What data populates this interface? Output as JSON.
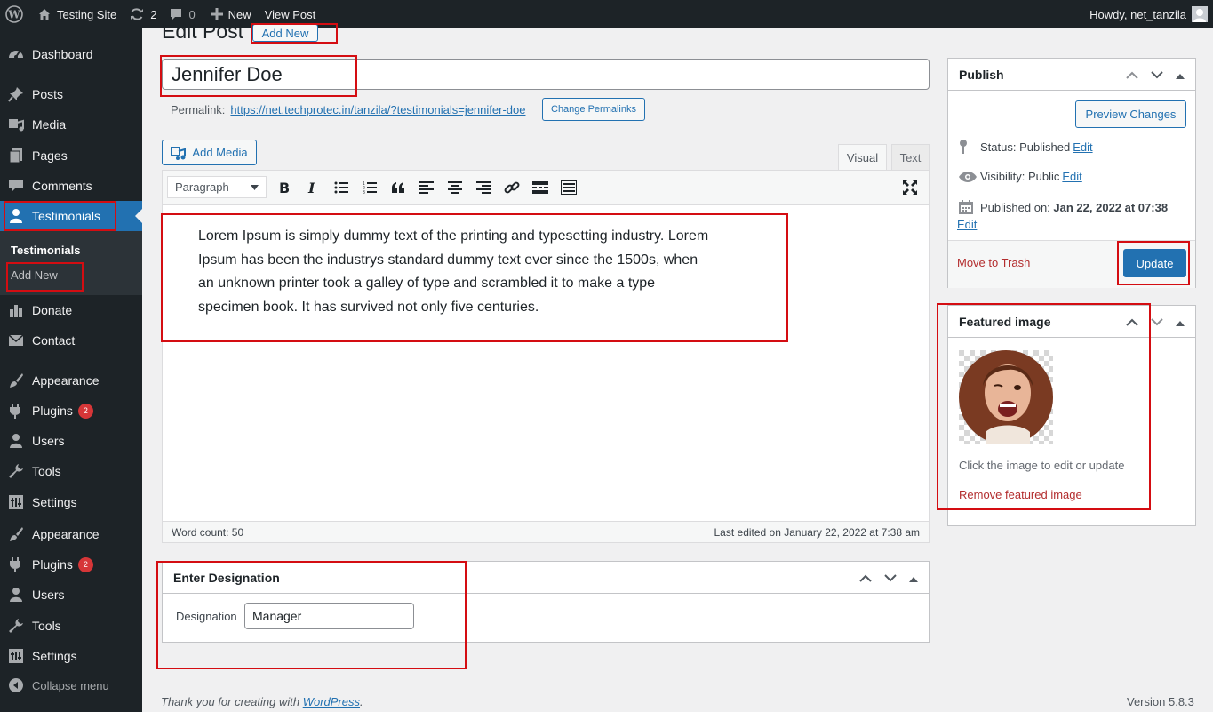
{
  "adminbar": {
    "site_name": "Testing Site",
    "updates_count": "2",
    "comments_count": "0",
    "new_label": "New",
    "view_post_label": "View Post",
    "howdy": "Howdy, net_tanzila"
  },
  "sidebar": {
    "items": [
      {
        "label": "Dashboard",
        "icon": "dashboard-icon"
      },
      {
        "label": "Posts",
        "icon": "pin-icon"
      },
      {
        "label": "Media",
        "icon": "media-icon"
      },
      {
        "label": "Pages",
        "icon": "pages-icon"
      },
      {
        "label": "Comments",
        "icon": "comment-icon"
      },
      {
        "label": "Testimonials",
        "icon": "user-icon"
      },
      {
        "label": "Donate",
        "icon": "chart-icon"
      },
      {
        "label": "Contact",
        "icon": "mail-icon"
      },
      {
        "label": "Appearance",
        "icon": "brush-icon"
      },
      {
        "label": "Plugins",
        "icon": "plugin-icon",
        "badge": "2"
      },
      {
        "label": "Users",
        "icon": "users-icon"
      },
      {
        "label": "Tools",
        "icon": "wrench-icon"
      },
      {
        "label": "Settings",
        "icon": "settings-icon"
      },
      {
        "label": "Appearance",
        "icon": "brush-icon"
      },
      {
        "label": "Plugins",
        "icon": "plugin-icon",
        "badge": "2"
      },
      {
        "label": "Users",
        "icon": "users-icon"
      },
      {
        "label": "Tools",
        "icon": "wrench-icon"
      },
      {
        "label": "Settings",
        "icon": "settings-icon"
      }
    ],
    "submenu": {
      "current": "Testimonials",
      "add_new": "Add New"
    },
    "collapse": "Collapse menu"
  },
  "page": {
    "title": "Edit Post",
    "add_new": "Add New",
    "post_title": "Jennifer Doe",
    "permalink_label": "Permalink:",
    "permalink_url": "https://net.techprotec.in/tanzila/?testimonials=jennifer-doe",
    "change_permalinks": "Change Permalinks"
  },
  "editor": {
    "add_media": "Add Media",
    "tab_visual": "Visual",
    "tab_text": "Text",
    "format_select": "Paragraph",
    "content_lines": [
      "Lorem Ipsum is simply dummy text of the printing and typesetting industry. Lorem",
      "Ipsum has been the industrys standard dummy text ever since the 1500s, when",
      "an unknown printer took a galley of type and scrambled it to make a type",
      "specimen book. It has survived not only five centuries."
    ],
    "word_count": "Word count: 50",
    "last_edited": "Last edited on January 22, 2022 at 7:38 am"
  },
  "designation_box": {
    "title": "Enter Designation",
    "label": "Designation",
    "value": "Manager"
  },
  "publish": {
    "title": "Publish",
    "preview": "Preview Changes",
    "status_label": "Status: ",
    "status_value": "Published",
    "visibility_label": "Visibility: ",
    "visibility_value": "Public",
    "published_on_label": "Published on: ",
    "published_on_value": "Jan 22, 2022 at 07:38",
    "edit": "Edit",
    "trash": "Move to Trash",
    "update": "Update"
  },
  "featured": {
    "title": "Featured image",
    "hint": "Click the image to edit or update",
    "remove": "Remove featured image"
  },
  "footer": {
    "thanks_prefix": "Thank you for creating with ",
    "wordpress": "WordPress",
    "thanks_suffix": ".",
    "version": "Version 5.8.3"
  },
  "colors": {
    "accent": "#2271b1",
    "sidebar_bg": "#1d2327",
    "highlight_box": "#d40d12",
    "danger": "#b32d2e"
  }
}
